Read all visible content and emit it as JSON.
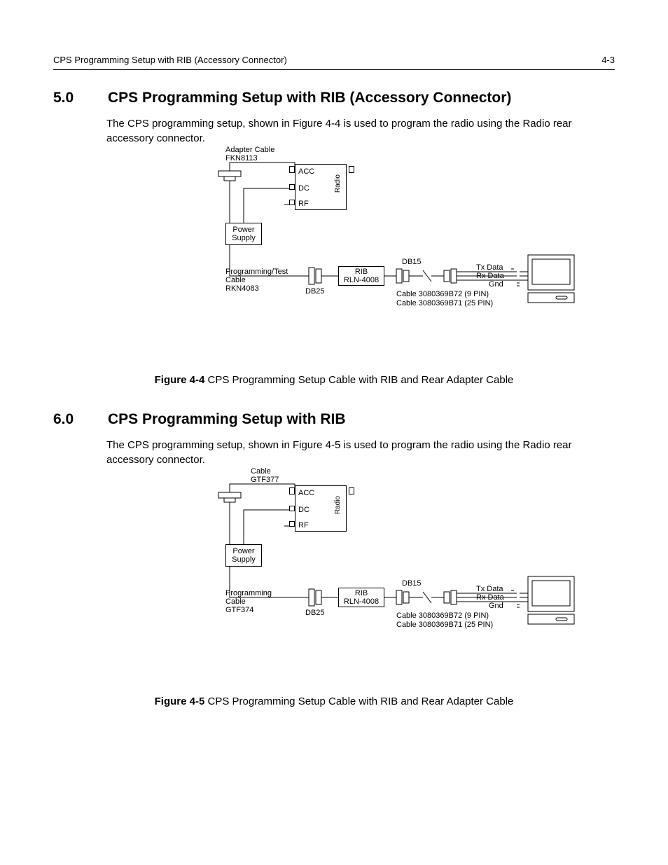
{
  "header": {
    "title": "CPS Programming Setup with RIB (Accessory Connector)",
    "page": "4-3"
  },
  "section5": {
    "num": "5.0",
    "title": "CPS Programming Setup with RIB (Accessory Connector)",
    "body": "The CPS programming setup, shown in Figure 4-4 is used to program the radio using the Radio rear accessory connector.",
    "diagram": {
      "adapter_label": "Adapter Cable\nFKN8113",
      "radio_ports": {
        "acc": "ACC",
        "dc": "DC",
        "rf": "RF",
        "radio": "Radio"
      },
      "power_supply": "Power\nSupply",
      "prog_cable": "Programming/Test\nCable\nRKN4083",
      "db25": "DB25",
      "rib": "RIB\nRLN-4008",
      "db15": "DB15",
      "signals": {
        "tx": "Tx Data",
        "rx": "Rx Data",
        "gnd": "Gnd"
      },
      "cable9": "Cable 3080369B72 (9 PIN)",
      "cable25": "Cable 3080369B71 (25 PIN)"
    },
    "figure_label": "Figure 4-4",
    "figure_caption": "CPS Programming Setup Cable with RIB and Rear Adapter Cable"
  },
  "section6": {
    "num": "6.0",
    "title": "CPS Programming Setup with RIB",
    "body": "The CPS programming setup, shown in Figure 4-5 is used to program the radio using the Radio rear accessory connector.",
    "diagram": {
      "adapter_label": "Cable\nGTF377",
      "radio_ports": {
        "acc": "ACC",
        "dc": "DC",
        "rf": "RF",
        "radio": "Radio"
      },
      "power_supply": "Power\nSupply",
      "prog_cable": "Programming\nCable\nGTF374",
      "db25": "DB25",
      "rib": "RIB\nRLN-4008",
      "db15": "DB15",
      "signals": {
        "tx": "Tx Data",
        "rx": "Rx Data",
        "gnd": "Gnd"
      },
      "cable9": "Cable 3080369B72 (9 PIN)",
      "cable25": "Cable 3080369B71 (25 PIN)"
    },
    "figure_label": "Figure 4-5",
    "figure_caption": "CPS Programming Setup Cable with RIB and Rear Adapter Cable"
  }
}
